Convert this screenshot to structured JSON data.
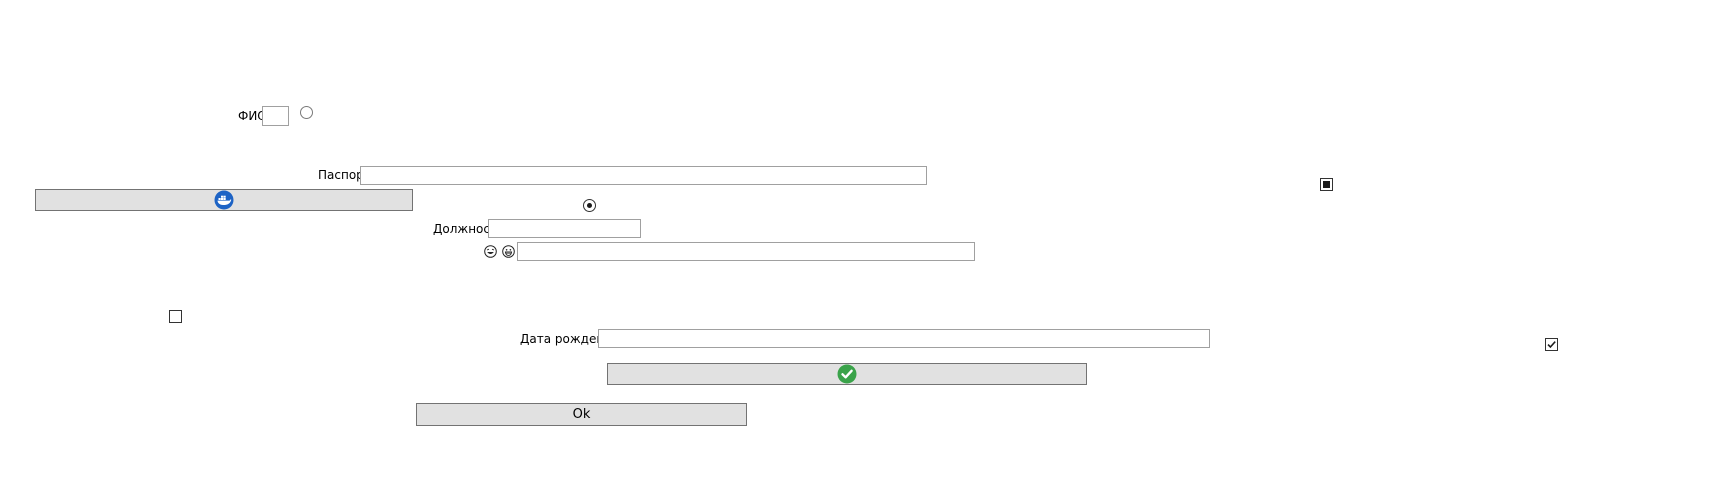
{
  "form": {
    "fio_label": "ФИО",
    "fio_value": "",
    "passport_label": "Паспорт",
    "passport_value": "",
    "position_label": "Должность",
    "position_value": "",
    "emoji_field_value": "",
    "birthdate_label": "Дата рождения",
    "birthdate_value": "",
    "ok_button_label": "Ok"
  },
  "controls": {
    "radio_top": {
      "checked": false
    },
    "radio_middle": {
      "checked": true
    },
    "checkbox_right_top": {
      "state": "indeterminate"
    },
    "checkbox_left": {
      "checked": false
    },
    "checkbox_right_bottom": {
      "checked": true
    }
  },
  "icons": {
    "docker_button_icon": "docker-icon",
    "confirm_button_icon": "check-circle-icon",
    "emoji_1": "rolling-laughing-emoji-icon",
    "emoji_2": "grinning-emoji-icon"
  },
  "colors": {
    "button_bg": "#e1e1e1",
    "docker_blue": "#1d63c5",
    "check_green": "#3aa34a"
  }
}
